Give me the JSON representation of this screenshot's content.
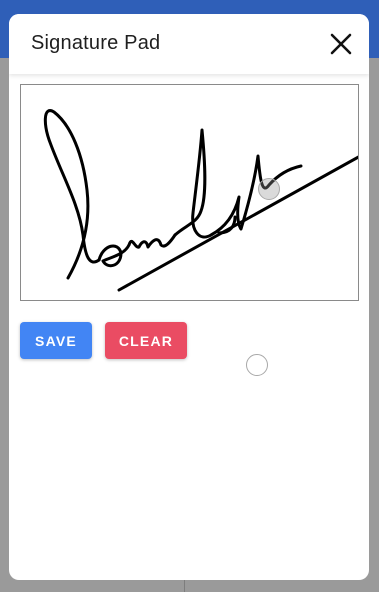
{
  "dialog": {
    "title": "Signature Pad",
    "close_icon": "close-icon"
  },
  "signature_pad": {
    "stroke_color": "#000000"
  },
  "buttons": {
    "save_label": "SAVE",
    "clear_label": "CLEAR"
  },
  "colors": {
    "app_bar": "#2f5fb8",
    "save_button": "#4285f4",
    "clear_button": "#ea4c63",
    "backdrop": "#9a9a9a"
  }
}
